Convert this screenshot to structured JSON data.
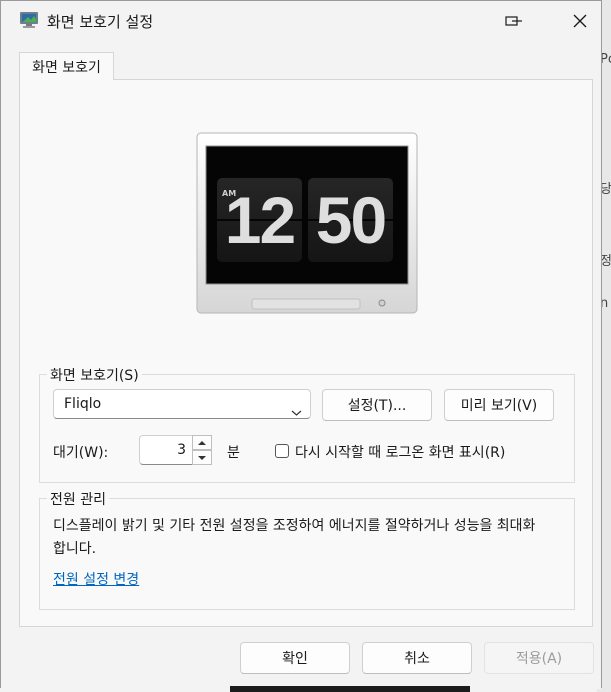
{
  "window": {
    "title": "화면 보호기 설정",
    "tab": "화면 보호기"
  },
  "preview": {
    "ampm": "AM",
    "hour": "12",
    "minute": "50"
  },
  "screensaver_group": {
    "label": "화면 보호기(S)",
    "selected": "Fliqlo",
    "settings_button": "설정(T)...",
    "preview_button": "미리 보기(V)",
    "wait_label": "대기(W):",
    "wait_value": "3",
    "wait_unit": "분",
    "resume_checkbox_label": "다시 시작할 때 로그온 화면 표시(R)",
    "resume_checked": false
  },
  "power_group": {
    "label": "전원 관리",
    "description": "디스플레이 밝기 및 기타 전원 설정을 조정하여 에너지를 절약하거나 성능을 최대화합니다.",
    "link": "전원 설정 변경"
  },
  "footer": {
    "ok": "확인",
    "cancel": "취소",
    "apply": "적용(A)"
  },
  "icons": {
    "title_icon": "monitor-icon",
    "minimize": "minimize-to-tray-icon",
    "close": "close-icon",
    "dropdown": "chevron-down-icon",
    "spin_up": "spin-up-icon",
    "spin_down": "spin-down-icon"
  },
  "background_fragments": [
    "Pc",
    "당",
    "정",
    "n"
  ]
}
